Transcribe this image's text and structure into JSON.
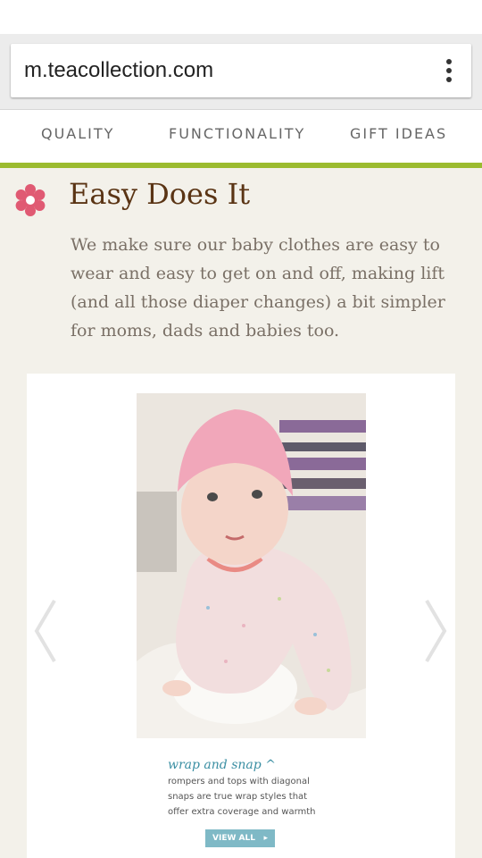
{
  "browser": {
    "url": "m.teacollection.com"
  },
  "nav": {
    "items": [
      {
        "label": "QUALITY"
      },
      {
        "label": "FUNCTIONALITY"
      },
      {
        "label": "GIFT IDEAS"
      }
    ]
  },
  "section": {
    "title": "Easy Does It",
    "body": "We make sure our baby clothes are easy to wear and easy to get on and off, making lift (and all those diaper changes) a bit simpler for moms, dads and babies too."
  },
  "slide": {
    "caption_title": "wrap and snap",
    "caption_text": "rompers and tops with diagonal snaps are true wrap styles that offer extra coverage and warmth",
    "button_label": "VIEW ALL"
  },
  "colors": {
    "accent_green": "#9bbb2f",
    "title_brown": "#5a3414",
    "flower_pink": "#e05a73",
    "button_teal": "#7fb9c6"
  }
}
